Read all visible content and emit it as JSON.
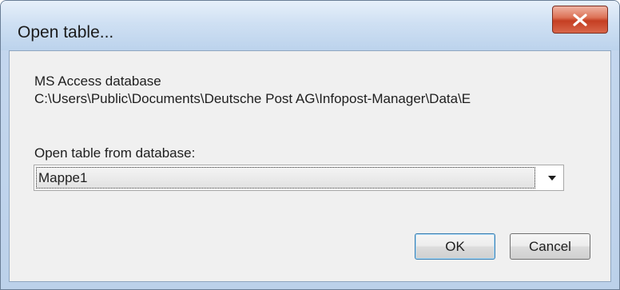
{
  "window": {
    "title": "Open table...",
    "close_icon": "close-icon"
  },
  "database": {
    "type_label": "MS Access database",
    "path": "C:\\Users\\Public\\Documents\\Deutsche Post AG\\Infopost-Manager\\Data\\E"
  },
  "table_select": {
    "label": "Open table from database:",
    "selected": "Mappe1",
    "arrow_icon": "chevron-down-icon"
  },
  "buttons": {
    "ok_label": "OK",
    "cancel_label": "Cancel"
  },
  "colors": {
    "close_button": "#c53e22",
    "default_button_border": "#3c7fb1"
  }
}
